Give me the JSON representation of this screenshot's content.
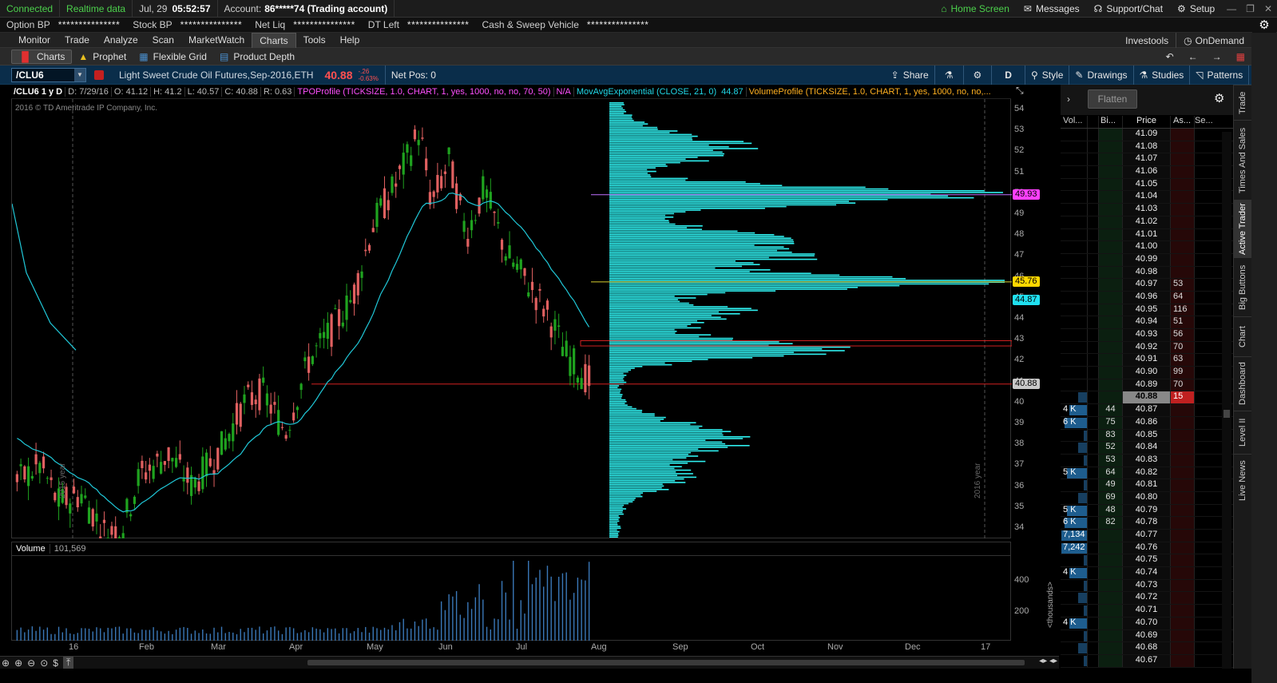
{
  "status_bar": {
    "connected": "Connected",
    "realtime": "Realtime data",
    "date": "Jul, 29",
    "time": "05:52:57",
    "account_label": "Account:",
    "account_value": "86*****74 (Trading account)",
    "home": "Home Screen",
    "messages": "Messages",
    "support": "Support/Chat",
    "setup": "Setup"
  },
  "balances": [
    {
      "label": "Option BP",
      "value": "***************"
    },
    {
      "label": "Stock BP",
      "value": "***************"
    },
    {
      "label": "Net Liq",
      "value": "***************"
    },
    {
      "label": "DT Left",
      "value": "***************"
    },
    {
      "label": "Cash & Sweep Vehicle",
      "value": "***************"
    }
  ],
  "nav": {
    "tabs": [
      "Monitor",
      "Trade",
      "Analyze",
      "Scan",
      "MarketWatch",
      "Charts",
      "Tools",
      "Help"
    ],
    "active": "Charts",
    "investools": "Investools",
    "ondemand": "OnDemand"
  },
  "subtabs": {
    "items": [
      "Charts",
      "Prophet",
      "Flexible Grid",
      "Product Depth"
    ],
    "active": "Charts"
  },
  "toolbar": {
    "symbol": "/CLU6",
    "description": "Light Sweet Crude Oil Futures,Sep-2016,ETH",
    "last": "40.88",
    "change": "-.26",
    "change_pct": "-0.63%",
    "netpos": "Net Pos: 0",
    "share": "Share",
    "period": "D",
    "style": "Style",
    "drawings": "Drawings",
    "studies": "Studies",
    "patterns": "Patterns"
  },
  "studies_line": {
    "title": "/CLU6 1 y D",
    "date": "D: 7/29/16",
    "open": "O: 41.12",
    "high": "H: 41.2",
    "low": "L: 40.57",
    "close": "C: 40.88",
    "range": "R: 0.63",
    "tpo": "TPOProfile (TICKSIZE, 1.0, CHART, 1, yes, 1000, no, no, 70, 50)",
    "tpo_val": "N/A",
    "ema": "MovAvgExponential (CLOSE, 21, 0)",
    "ema_val": "44.87",
    "vp": "VolumeProfile (TICKSIZE, 1.0, CHART, 1, yes, 1000, no, no,..."
  },
  "chart": {
    "copyright": "2016 © TD Ameritrade IP Company, Inc.",
    "year_labels": [
      "2015 year",
      "2016 year"
    ],
    "price_ticks": [
      "54",
      "53",
      "52",
      "51",
      "50",
      "49",
      "48",
      "47",
      "46",
      "45",
      "44",
      "43",
      "42",
      "41",
      "40",
      "39",
      "38",
      "37",
      "36",
      "35",
      "34"
    ],
    "badges": [
      {
        "value": "49.93",
        "color": "#ff40ff"
      },
      {
        "value": "45.76",
        "color": "#ffd700"
      },
      {
        "value": "44.87",
        "color": "#20e0f0"
      },
      {
        "value": "40.88",
        "color": "#c8c8c8"
      }
    ],
    "time_ticks": [
      "16",
      "Feb",
      "Mar",
      "Apr",
      "May",
      "Jun",
      "Jul",
      "Aug",
      "Sep",
      "Oct",
      "Nov",
      "Dec",
      "17"
    ],
    "volume_label": "Volume",
    "volume_value": "101,569",
    "volume_ticks": [
      "400",
      "200"
    ],
    "volume_unit": "<thousands>"
  },
  "chart_data": {
    "type": "candlestick",
    "title": "/CLU6 1 y D",
    "y_range": [
      33.5,
      54.5
    ],
    "ema_period": 21,
    "last_close": 40.88,
    "profile_lines": [
      49.93,
      45.76
    ]
  },
  "ladder": {
    "flatten": "Flatten",
    "headers": [
      "Vol...",
      "",
      "Bi...",
      "Price",
      "As...",
      "Se..."
    ],
    "rows": [
      {
        "vol": "",
        "bid": "",
        "price": "41.09",
        "ask": ""
      },
      {
        "vol": "",
        "bid": "",
        "price": "41.08",
        "ask": ""
      },
      {
        "vol": "",
        "bid": "",
        "price": "41.07",
        "ask": ""
      },
      {
        "vol": "",
        "bid": "",
        "price": "41.06",
        "ask": ""
      },
      {
        "vol": "",
        "bid": "",
        "price": "41.05",
        "ask": ""
      },
      {
        "vol": "",
        "bid": "",
        "price": "41.04",
        "ask": ""
      },
      {
        "vol": "",
        "bid": "",
        "price": "41.03",
        "ask": ""
      },
      {
        "vol": "",
        "bid": "",
        "price": "41.02",
        "ask": ""
      },
      {
        "vol": "",
        "bid": "",
        "price": "41.01",
        "ask": ""
      },
      {
        "vol": "",
        "bid": "",
        "price": "41.00",
        "ask": ""
      },
      {
        "vol": "",
        "bid": "",
        "price": "40.99",
        "ask": ""
      },
      {
        "vol": "",
        "bid": "",
        "price": "40.98",
        "ask": ""
      },
      {
        "vol": "",
        "bid": "",
        "price": "40.97",
        "ask": "53"
      },
      {
        "vol": "",
        "bid": "",
        "price": "40.96",
        "ask": "64"
      },
      {
        "vol": "",
        "bid": "",
        "price": "40.95",
        "ask": "116"
      },
      {
        "vol": "",
        "bid": "",
        "price": "40.94",
        "ask": "51"
      },
      {
        "vol": "",
        "bid": "",
        "price": "40.93",
        "ask": "56"
      },
      {
        "vol": "",
        "bid": "",
        "price": "40.92",
        "ask": "70"
      },
      {
        "vol": "",
        "bid": "",
        "price": "40.91",
        "ask": "63"
      },
      {
        "vol": "",
        "bid": "",
        "price": "40.90",
        "ask": "99"
      },
      {
        "vol": "",
        "bid": "",
        "price": "40.89",
        "ask": "70"
      },
      {
        "vol": "",
        "bid": "",
        "price": "40.88",
        "ask": "15",
        "current": true
      },
      {
        "vol": "4 K",
        "bid": "44",
        "price": "40.87",
        "ask": ""
      },
      {
        "vol": "6 K",
        "bid": "75",
        "price": "40.86",
        "ask": ""
      },
      {
        "vol": "",
        "bid": "83",
        "price": "40.85",
        "ask": ""
      },
      {
        "vol": "",
        "bid": "52",
        "price": "40.84",
        "ask": ""
      },
      {
        "vol": "",
        "bid": "53",
        "price": "40.83",
        "ask": ""
      },
      {
        "vol": "5 K",
        "bid": "64",
        "price": "40.82",
        "ask": ""
      },
      {
        "vol": "",
        "bid": "49",
        "price": "40.81",
        "ask": ""
      },
      {
        "vol": "",
        "bid": "69",
        "price": "40.80",
        "ask": ""
      },
      {
        "vol": "5 K",
        "bid": "48",
        "price": "40.79",
        "ask": ""
      },
      {
        "vol": "6 K",
        "bid": "82",
        "price": "40.78",
        "ask": ""
      },
      {
        "vol": "7,134",
        "bid": "",
        "price": "40.77",
        "ask": ""
      },
      {
        "vol": "7,242",
        "bid": "",
        "price": "40.76",
        "ask": ""
      },
      {
        "vol": "",
        "bid": "",
        "price": "40.75",
        "ask": ""
      },
      {
        "vol": "4 K",
        "bid": "",
        "price": "40.74",
        "ask": ""
      },
      {
        "vol": "",
        "bid": "",
        "price": "40.73",
        "ask": ""
      },
      {
        "vol": "",
        "bid": "",
        "price": "40.72",
        "ask": ""
      },
      {
        "vol": "",
        "bid": "",
        "price": "40.71",
        "ask": ""
      },
      {
        "vol": "4 K",
        "bid": "",
        "price": "40.70",
        "ask": ""
      },
      {
        "vol": "",
        "bid": "",
        "price": "40.69",
        "ask": ""
      },
      {
        "vol": "",
        "bid": "",
        "price": "40.68",
        "ask": ""
      },
      {
        "vol": "",
        "bid": "",
        "price": "40.67",
        "ask": ""
      }
    ]
  },
  "side_tabs": [
    "Trade",
    "Times And Sales",
    "Active Trader",
    "Big Buttons",
    "Chart",
    "Dashboard",
    "Level II",
    "Live News"
  ],
  "side_tab_active": "Active Trader",
  "colors": {
    "up": "#1fa31f",
    "down": "#e06060",
    "ema": "#20c8d8",
    "profile": "#2ff0f0",
    "accent_bg": "#0a2d4a"
  }
}
